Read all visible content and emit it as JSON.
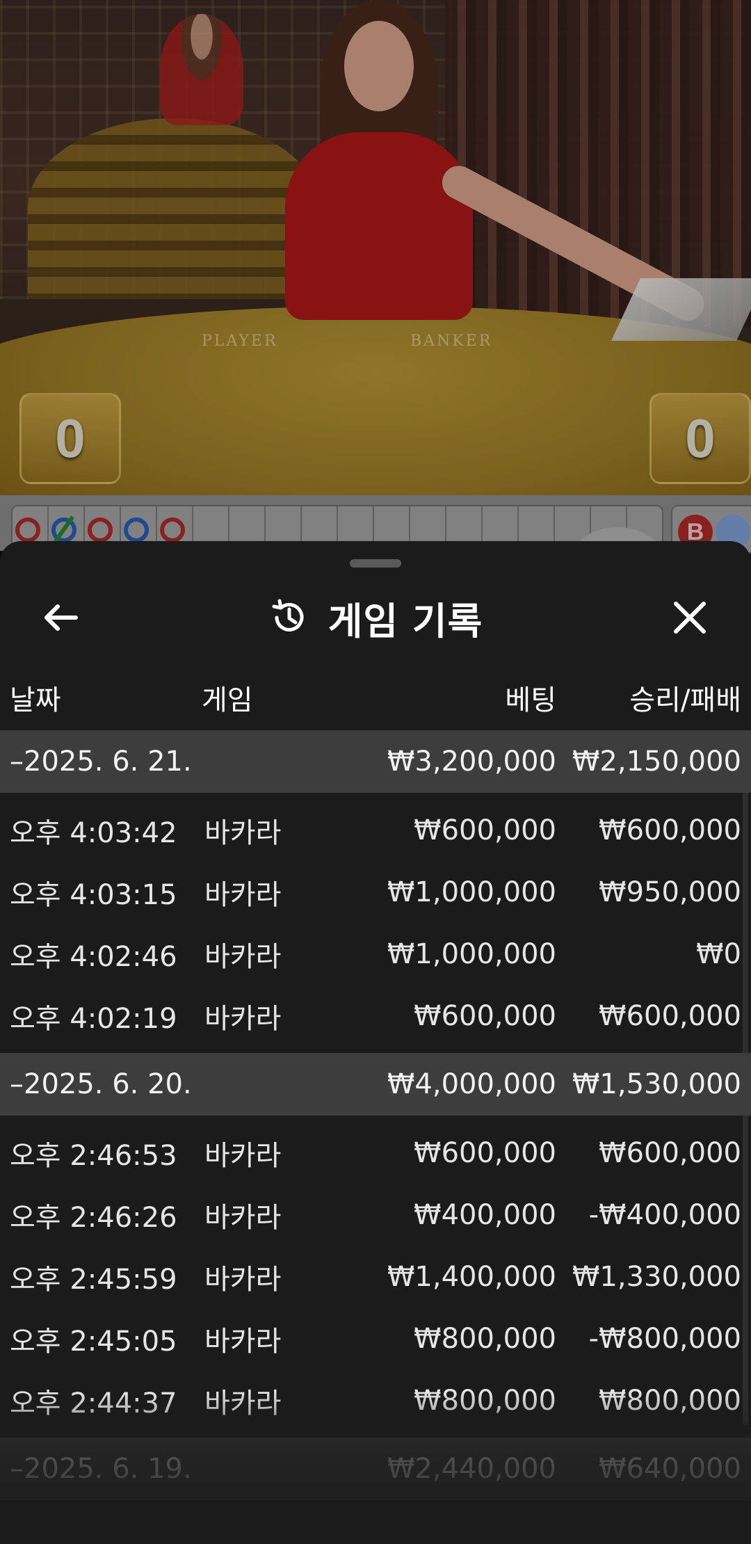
{
  "video": {
    "table_label_player": "PLAYER",
    "table_label_banker": "BANKER",
    "player_score": "0",
    "banker_score": "0"
  },
  "roadmap": {
    "badge_label": "B",
    "colors": {
      "banker": "#b22a2a",
      "player": "#2a5fb8",
      "tie": "#1f8a3a"
    }
  },
  "history_sheet": {
    "title": "게임 기록",
    "icons": {
      "back": "arrow-left-icon",
      "title": "history-icon",
      "close": "close-icon"
    },
    "columns": {
      "date": "날짜",
      "game": "게임",
      "bet": "베팅",
      "winloss": "승리/패배"
    },
    "groups": [
      {
        "date": "–2025. 6. 21.",
        "bet_total": "₩3,200,000",
        "winloss_total": "₩2,150,000",
        "rows": [
          {
            "time": "오후 4:03:42",
            "game": "바카라",
            "bet": "₩600,000",
            "winloss": "₩600,000"
          },
          {
            "time": "오후 4:03:15",
            "game": "바카라",
            "bet": "₩1,000,000",
            "winloss": "₩950,000"
          },
          {
            "time": "오후 4:02:46",
            "game": "바카라",
            "bet": "₩1,000,000",
            "winloss": "₩0"
          },
          {
            "time": "오후 4:02:19",
            "game": "바카라",
            "bet": "₩600,000",
            "winloss": "₩600,000"
          }
        ]
      },
      {
        "date": "–2025. 6. 20.",
        "bet_total": "₩4,000,000",
        "winloss_total": "₩1,530,000",
        "rows": [
          {
            "time": "오후 2:46:53",
            "game": "바카라",
            "bet": "₩600,000",
            "winloss": "₩600,000"
          },
          {
            "time": "오후 2:46:26",
            "game": "바카라",
            "bet": "₩400,000",
            "winloss": "-₩400,000"
          },
          {
            "time": "오후 2:45:59",
            "game": "바카라",
            "bet": "₩1,400,000",
            "winloss": "₩1,330,000"
          },
          {
            "time": "오후 2:45:05",
            "game": "바카라",
            "bet": "₩800,000",
            "winloss": "-₩800,000"
          },
          {
            "time": "오후 2:44:37",
            "game": "바카라",
            "bet": "₩800,000",
            "winloss": "₩800,000"
          }
        ]
      },
      {
        "date": "–2025. 6. 19.",
        "bet_total": "₩2,440,000",
        "winloss_total": "₩640,000",
        "rows": []
      }
    ]
  }
}
